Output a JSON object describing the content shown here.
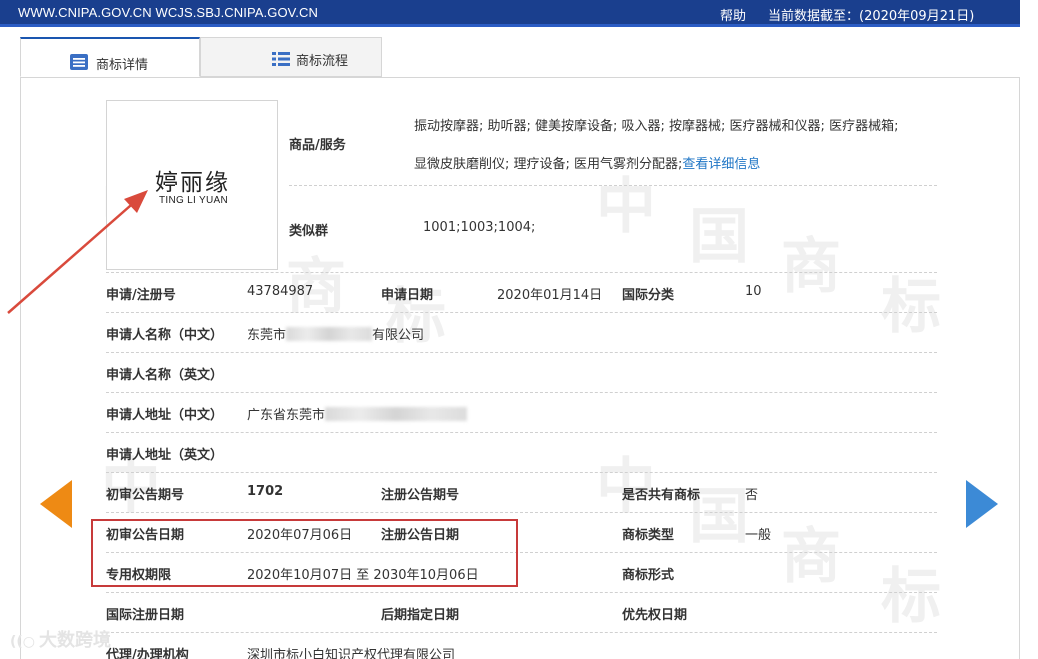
{
  "topbar": {
    "urls": "WWW.CNIPA.GOV.CN WCJS.SBJ.CNIPA.GOV.CN",
    "help": "帮助",
    "as_of": "当前数据截至：(2020年09月21日)"
  },
  "tabs": [
    {
      "label": "商标详情",
      "icon": "list-detail-icon",
      "active": true
    },
    {
      "label": "商标流程",
      "icon": "list-flow-icon",
      "active": false
    }
  ],
  "logo": {
    "cn": "婷丽缘",
    "en": "TING LI YUAN"
  },
  "goods": {
    "label": "商品/服务",
    "line1": "振动按摩器; 助听器; 健美按摩设备; 吸入器; 按摩器械; 医疗器械和仪器; 医疗器械箱;",
    "line2": "显微皮肤磨削仪; 理疗设备; 医用气雾剂分配器;",
    "more": "查看详细信息"
  },
  "similar_group": {
    "label": "类似群",
    "value": "1001;1003;1004;"
  },
  "reg_no": {
    "label": "申请/注册号",
    "value": "43784987"
  },
  "app_date": {
    "label": "申请日期",
    "value": "2020年01月14日"
  },
  "intl_class": {
    "label": "国际分类",
    "value": "10"
  },
  "applicant_cn": {
    "label": "申请人名称（中文）",
    "prefix": "东莞市",
    "suffix": "有限公司"
  },
  "applicant_en": {
    "label": "申请人名称（英文）"
  },
  "address_cn": {
    "label": "申请人地址（中文）",
    "prefix": "广东省东莞市"
  },
  "address_en": {
    "label": "申请人地址（英文）"
  },
  "prelim_issue": {
    "label": "初审公告期号",
    "value": "1702"
  },
  "reg_issue": {
    "label": "注册公告期号"
  },
  "shared": {
    "label": "是否共有商标",
    "value": "否"
  },
  "prelim_date": {
    "label": "初审公告日期",
    "value": "2020年07月06日"
  },
  "reg_date": {
    "label": "注册公告日期"
  },
  "mark_type": {
    "label": "商标类型",
    "value": "一般"
  },
  "exclusive": {
    "label": "专用权期限",
    "value": "2020年10月07日 至 2030年10月06日"
  },
  "mark_form": {
    "label": "商标形式"
  },
  "intl_reg_date": {
    "label": "国际注册日期"
  },
  "later_date": {
    "label": "后期指定日期"
  },
  "priority_date": {
    "label": "优先权日期"
  },
  "agent": {
    "label": "代理/办理机构",
    "value": "深圳市标小白知识产权代理有限公司"
  },
  "watermark": {
    "chars": [
      "中",
      "国",
      "商",
      "标"
    ],
    "footer": "大数跨境"
  },
  "colors": {
    "topbar": "#1a3f8e",
    "link": "#1f76c6",
    "red_box": "#c73a3a",
    "arrow": "#d94a3c",
    "nav_left": "#ee8a14",
    "nav_right": "#3c8ad6"
  }
}
